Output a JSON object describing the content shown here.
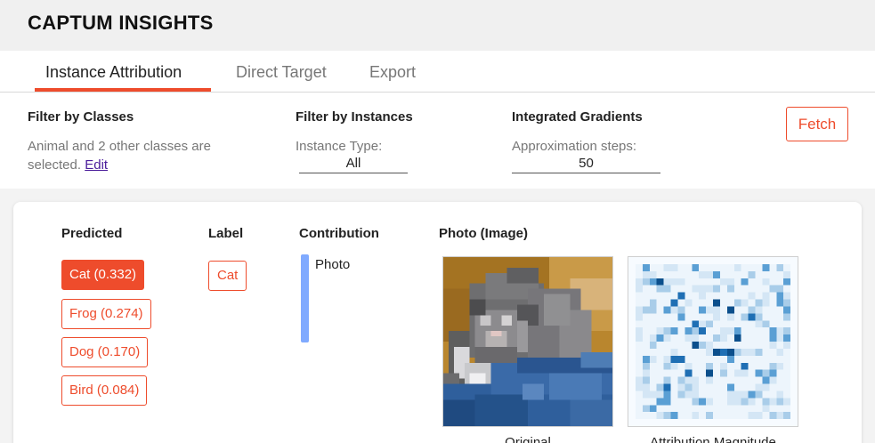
{
  "app": {
    "title": "CAPTUM INSIGHTS"
  },
  "tabs": [
    {
      "label": "Instance Attribution",
      "active": true
    },
    {
      "label": "Direct Target",
      "active": false
    },
    {
      "label": "Export",
      "active": false
    }
  ],
  "filters": {
    "classes": {
      "heading": "Filter by Classes",
      "text": "Animal and 2 other classes are selected.",
      "link": "Edit"
    },
    "instances": {
      "heading": "Filter by Instances",
      "type_label": "Instance Type:",
      "type_value": "All"
    },
    "method": {
      "heading": "Integrated Gradients",
      "steps_label": "Approximation steps:",
      "steps_value": "50"
    },
    "fetch_label": "Fetch"
  },
  "results": {
    "headers": {
      "predicted": "Predicted",
      "label": "Label",
      "contribution": "Contribution",
      "photo": "Photo (Image)"
    },
    "predictions": [
      {
        "text": "Cat (0.332)",
        "selected": true
      },
      {
        "text": "Frog (0.274)",
        "selected": false
      },
      {
        "text": "Dog (0.170)",
        "selected": false
      },
      {
        "text": "Bird (0.084)",
        "selected": false
      }
    ],
    "label": "Cat",
    "contribution": {
      "name": "Photo",
      "color": "#80aaff"
    },
    "images": {
      "original_caption": "Original",
      "attribution_caption": "Attribution Magnitude"
    }
  },
  "colors": {
    "accent": "#ee4c2c",
    "link": "#4b1d9b",
    "contribution_bar": "#80aaff"
  }
}
